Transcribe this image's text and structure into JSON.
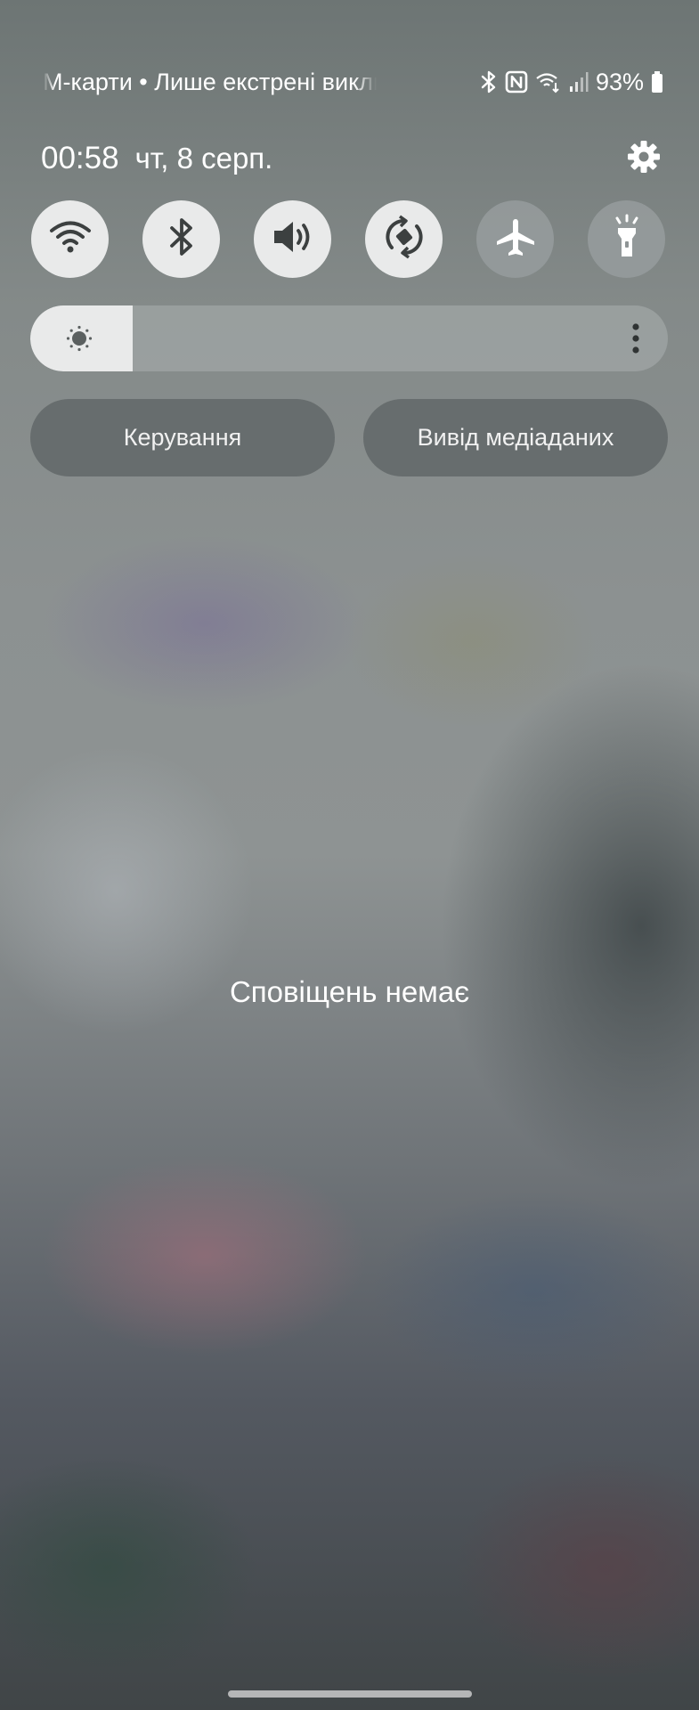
{
  "status_bar": {
    "carrier_text": "М-карти • Лише екстрені виклики",
    "battery": "93%",
    "icons": [
      "bluetooth-icon",
      "nfc-icon",
      "wifi-calling-icon",
      "signal-icon",
      "battery-icon"
    ]
  },
  "header": {
    "time": "00:58",
    "date": "чт, 8 серп."
  },
  "quick_toggles": [
    {
      "name": "wifi",
      "icon": "wifi-icon",
      "state": "on"
    },
    {
      "name": "bluetooth",
      "icon": "bluetooth-icon",
      "state": "on"
    },
    {
      "name": "sound",
      "icon": "sound-icon",
      "state": "on"
    },
    {
      "name": "auto-rotate",
      "icon": "auto-rotate-icon",
      "state": "on"
    },
    {
      "name": "airplane-mode",
      "icon": "airplane-icon",
      "state": "off"
    },
    {
      "name": "flashlight",
      "icon": "flashlight-icon",
      "state": "off"
    }
  ],
  "brightness": {
    "level": 0.16
  },
  "buttons": {
    "device_control": "Керування",
    "media_output": "Вивід медіаданих"
  },
  "notifications": {
    "empty_text": "Сповіщень немає"
  },
  "colors": {
    "toggle_on": "#e9eaea",
    "icon_dark": "#3c4040",
    "text": "#ffffff"
  }
}
